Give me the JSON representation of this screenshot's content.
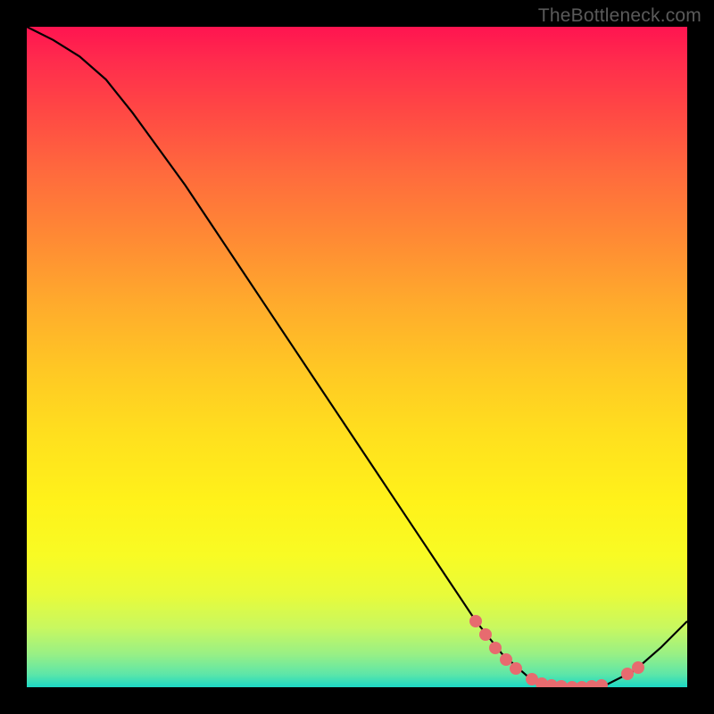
{
  "watermark": "TheBottleneck.com",
  "chart_data": {
    "type": "line",
    "title": "",
    "xlabel": "",
    "ylabel": "",
    "xlim": [
      0,
      100
    ],
    "ylim": [
      0,
      100
    ],
    "curve": {
      "x": [
        0,
        4,
        8,
        12,
        16,
        20,
        24,
        28,
        32,
        36,
        40,
        44,
        48,
        52,
        56,
        60,
        64,
        68,
        72,
        76,
        80,
        84,
        88,
        92,
        96,
        100
      ],
      "y": [
        100,
        98,
        95.5,
        92,
        87,
        81.5,
        76,
        70,
        64,
        58,
        52,
        46,
        40,
        34,
        28,
        22,
        16,
        10,
        5,
        1.5,
        0.2,
        0,
        0.5,
        2.5,
        6,
        10
      ]
    },
    "points": [
      {
        "x": 68,
        "y": 10
      },
      {
        "x": 69.5,
        "y": 8
      },
      {
        "x": 71,
        "y": 6
      },
      {
        "x": 72.5,
        "y": 4.2
      },
      {
        "x": 74,
        "y": 2.8
      },
      {
        "x": 76.5,
        "y": 1.2
      },
      {
        "x": 78,
        "y": 0.6
      },
      {
        "x": 79.5,
        "y": 0.3
      },
      {
        "x": 81,
        "y": 0.1
      },
      {
        "x": 82.5,
        "y": 0
      },
      {
        "x": 84,
        "y": 0
      },
      {
        "x": 85.5,
        "y": 0.1
      },
      {
        "x": 87,
        "y": 0.3
      },
      {
        "x": 91,
        "y": 2
      },
      {
        "x": 92.5,
        "y": 3
      }
    ],
    "background_gradient": {
      "top": "#ff1450",
      "mid": "#ffe01e",
      "bottom": "#1cd8c5"
    }
  }
}
